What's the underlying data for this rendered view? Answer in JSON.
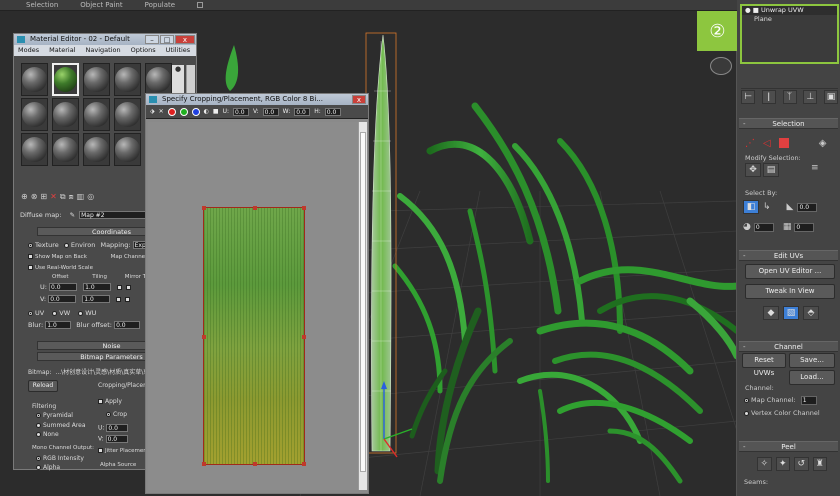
{
  "topbar": {
    "items": [
      "Selection",
      "Object Paint",
      "Populate"
    ]
  },
  "badge": {
    "text": "②"
  },
  "modifier_stack": {
    "items": [
      "Unwrap UVW",
      "Plane"
    ]
  },
  "selection": {
    "title": "Selection",
    "modify_label": "Modify Selection:",
    "select_by": "Select By:",
    "spin1": "0.0",
    "spin2": "0",
    "spin3": "0"
  },
  "edit_uvs": {
    "title": "Edit UVs",
    "open_editor": "Open UV Editor ...",
    "tweak": "Tweak In View"
  },
  "channel": {
    "title": "Channel",
    "reset": "Reset UVWs",
    "save": "Save...",
    "load": "Load...",
    "channel_label": "Channel:",
    "map_channel": "Map Channel:",
    "map_channel_value": "1",
    "vertex_color": "Vertex Color Channel"
  },
  "peel": {
    "title": "Peel",
    "seams": "Seams:"
  },
  "material_editor": {
    "title": "Material Editor - 02 - Default",
    "menu": [
      "Modes",
      "Material",
      "Navigation",
      "Options",
      "Utilities"
    ],
    "diffuse_label": "Diffuse map:",
    "map_name": "Map #2",
    "coordinates": {
      "title": "Coordinates",
      "texture": "Texture",
      "environ": "Environ",
      "mapping_label": "Mapping:",
      "mapping_value": "Explicit Map Channel",
      "show_map": "Show Map on Back",
      "map_channel": "Map Channel",
      "real_world": "Use Real-World Scale",
      "offset": "Offset",
      "tiling": "Tiling",
      "mirror_tile": "Mirror Tile",
      "u_label": "U:",
      "v_label": "V:",
      "u_offset": "0.0",
      "v_offset": "0.0",
      "u_tiling": "1.0",
      "v_tiling": "1.0",
      "uv": "UV",
      "vw": "VW",
      "wu": "WU",
      "blur_label": "Blur:",
      "blur_value": "1.0",
      "blur_offset_label": "Blur offset:",
      "blur_offset_value": "0.0"
    },
    "noise_title": "Noise",
    "bitmap_params": {
      "title": "Bitmap Parameters",
      "bitmap_label": "Bitmap:",
      "bitmap_path": "...\\材创意设计\\灵感\\材质\\真实草\\草",
      "reload": "Reload",
      "cropping": "Cropping/Placement",
      "filtering": "Filtering",
      "pyramidal": "Pyramidal",
      "summed": "Summed Area",
      "none": "None",
      "apply": "Apply",
      "crop": "Crop",
      "u": "U:",
      "v": "V:",
      "u_val": "0.0",
      "v_val": "0.0",
      "jitter": "Jitter Placement",
      "mono": "Mono Channel Output:",
      "rgb_intensity": "RGB Intensity",
      "alpha": "Alpha",
      "alpha_source": "Alpha Source"
    }
  },
  "crop_window": {
    "title": "Specify Cropping/Placement, RGB Color 8 Bi...",
    "u_label": "U:",
    "u_val": "0.0",
    "v_label": "V:",
    "v_val": "0.0",
    "w_label": "W:",
    "w_val": "0.0",
    "h_label": "H:",
    "h_val": "0.0"
  },
  "colors": {
    "accent_green": "#8dc63f",
    "grass": "#2f9a2f",
    "selection_orange": "#d9772b"
  }
}
